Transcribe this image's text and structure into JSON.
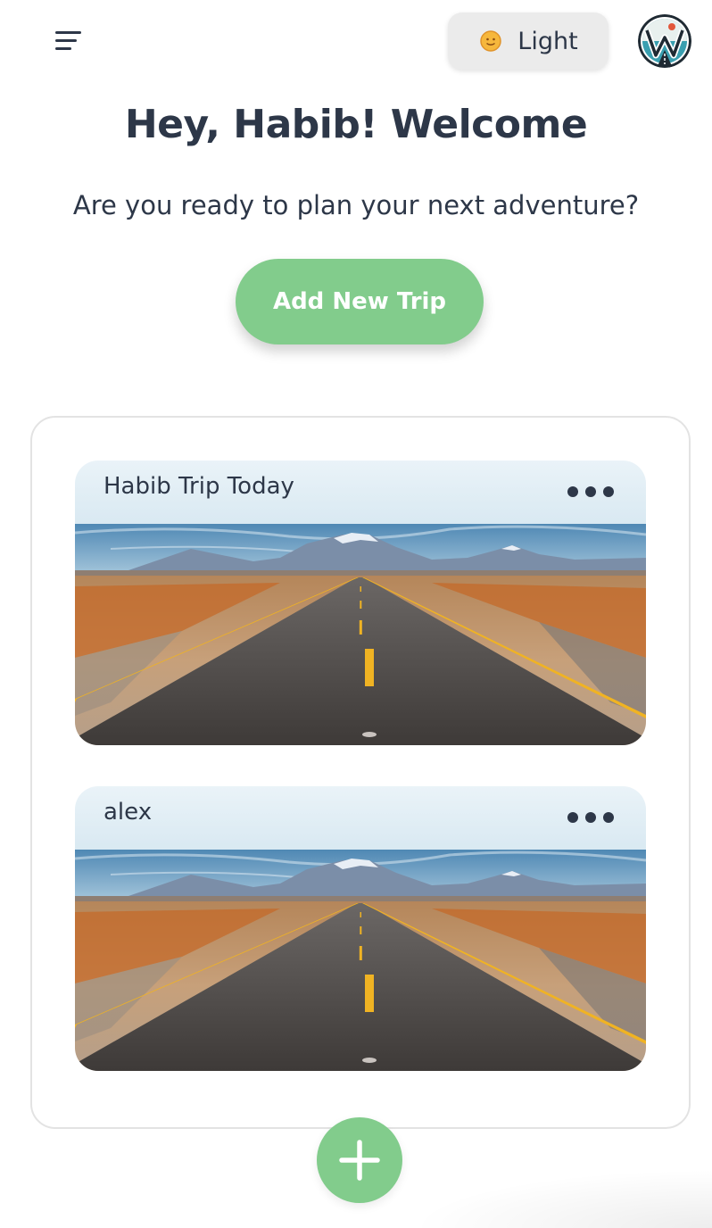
{
  "header": {
    "menu_icon": "hamburger-menu-icon",
    "theme_toggle": {
      "icon": "sun-icon",
      "label": "Light"
    },
    "avatar_icon": "avatar-logo"
  },
  "welcome": {
    "title": "Hey, Habib! Welcome",
    "subtitle": "Are you ready to plan your next adventure?"
  },
  "actions": {
    "add_trip_label": "Add New Trip",
    "fab_icon": "plus-icon"
  },
  "trips": [
    {
      "title": "Habib Trip Today",
      "menu_icon": "more-horizontal-icon",
      "image": "desert-road-landscape"
    },
    {
      "title": "alex",
      "menu_icon": "more-horizontal-icon",
      "image": "desert-road-landscape"
    }
  ],
  "colors": {
    "accent_green": "#82cc8c",
    "text_dark": "#2d3748",
    "toggle_bg": "#ebebeb"
  }
}
